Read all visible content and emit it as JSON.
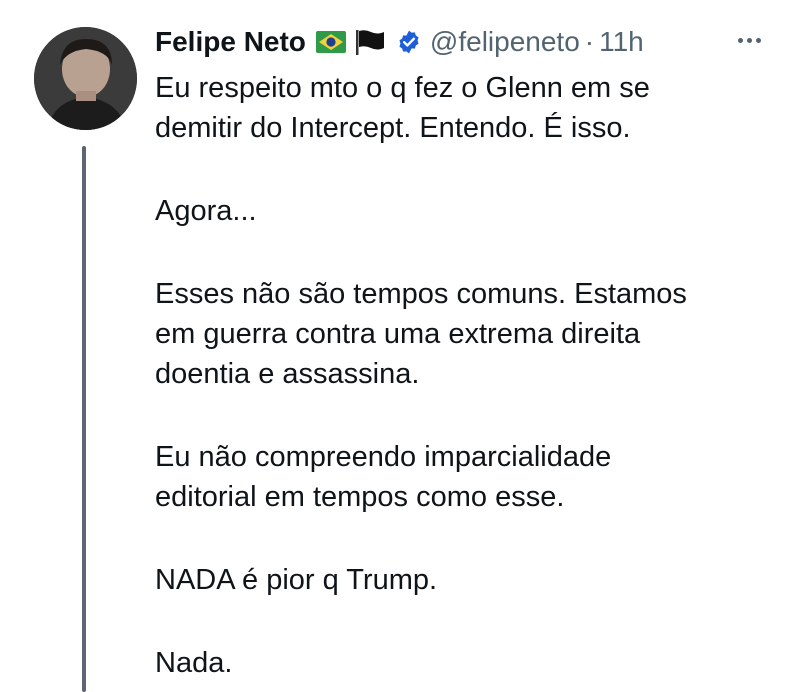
{
  "tweet": {
    "display_name": "Felipe Neto",
    "badges": [
      "brazil-flag-icon",
      "black-flag-icon",
      "verified-badge-icon"
    ],
    "handle": "@felipeneto",
    "separator": "·",
    "time": "11h",
    "more_icon": "more-horizontal-icon",
    "paragraphs": [
      [
        "Eu respeito mto o q fez o Glenn em se",
        "demitir do Intercept. Entendo. É isso."
      ],
      [
        "Agora..."
      ],
      [
        "Esses não são tempos comuns. Estamos",
        "em guerra contra uma extrema direita",
        "doentia e assassina."
      ],
      [
        "Eu não compreendo imparcialidade",
        "editorial em tempos como esse."
      ],
      [
        "NADA é pior q Trump."
      ],
      [
        "Nada."
      ]
    ]
  },
  "colors": {
    "text": "#0f1419",
    "secondary": "#536471",
    "verified": "#1d9bf0",
    "thread_line": "#5c6670"
  }
}
